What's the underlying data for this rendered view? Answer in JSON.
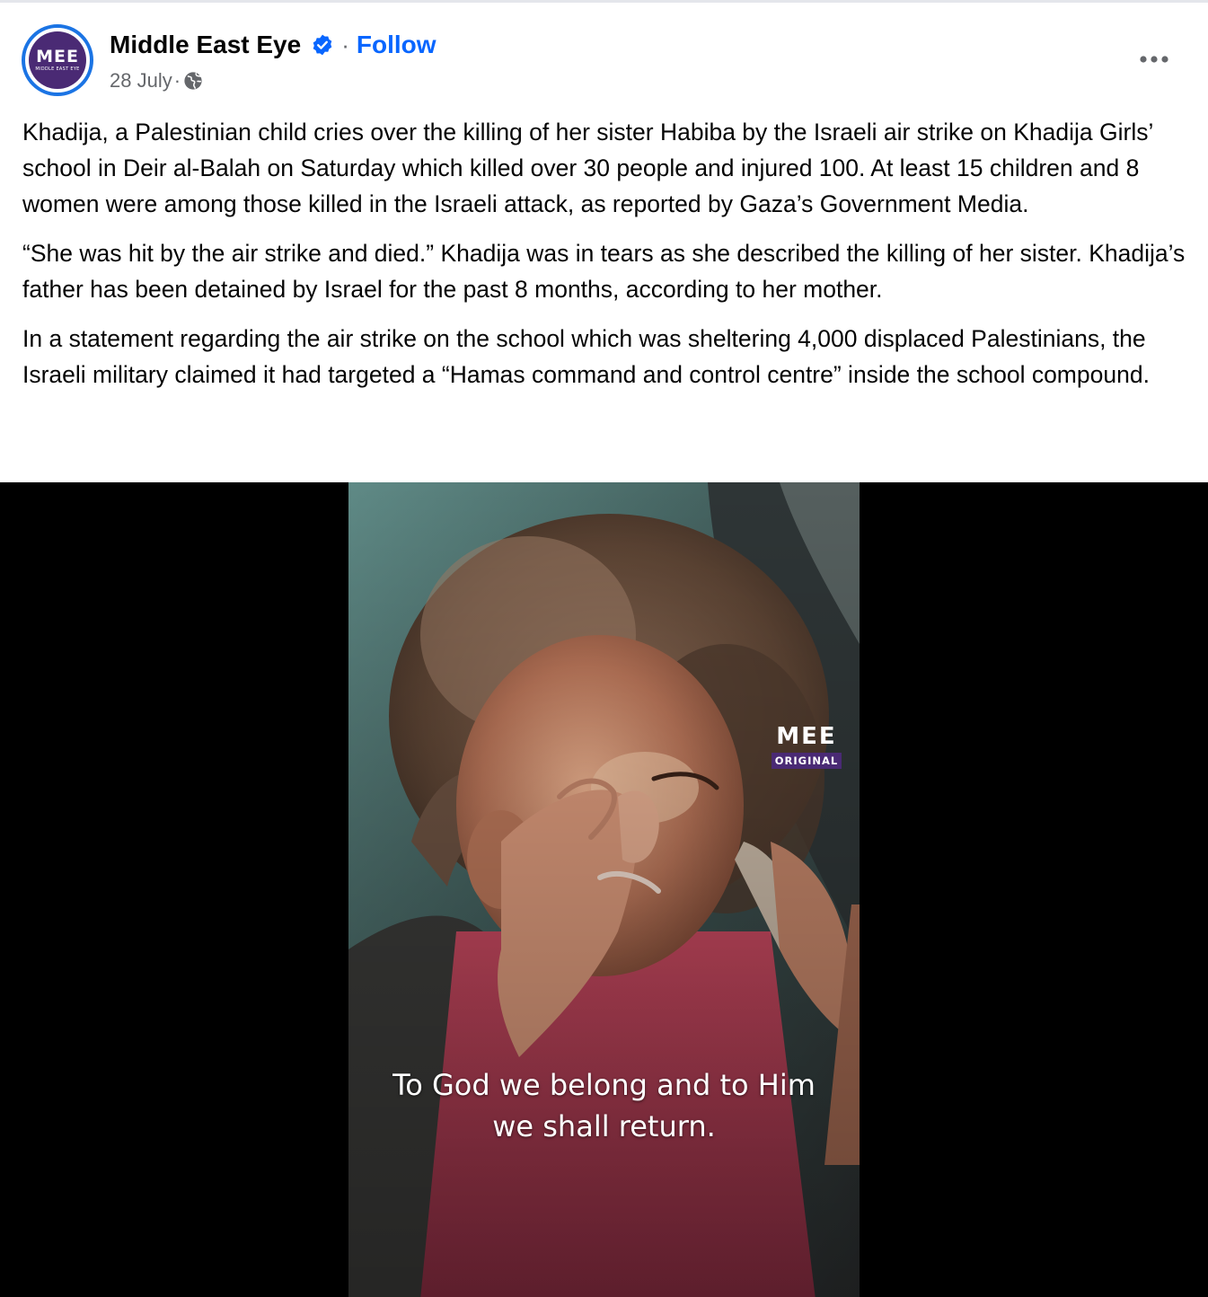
{
  "post": {
    "author": {
      "name": "Middle East Eye",
      "avatar_logo": "MEE",
      "avatar_subtext": "MIDDLE EAST EYE",
      "verified_icon": "verified-badge-icon"
    },
    "separator": "·",
    "follow_label": "Follow",
    "date": "28 July",
    "audience_icon": "globe-icon",
    "more_icon": "more-options-icon",
    "caption": [
      "Khadija, a Palestinian child cries over the killing of her sister Habiba by the Israeli air strike on Khadija Girls’ school in Deir al-Balah on Saturday which killed over 30 people and injured 100. At least 15 children and 8 women were among those killed in the Israeli attack, as reported by Gaza’s Government Media.",
      "“She was hit by the air strike and died.” Khadija was in tears as she described the killing of her sister. Khadija’s father has been detained by Israel for the past 8 months, according to her mother.",
      "In a statement regarding the air strike on the school which was sheltering 4,000 displaced Palestinians, the Israeli military claimed it had targeted a “Hamas command and control centre” inside the school compound."
    ],
    "media": {
      "watermark_logo": "MEE",
      "watermark_badge": "ORIGINAL",
      "subtitle_lines": [
        "To God we belong and to Him",
        "we shall return."
      ]
    }
  },
  "colors": {
    "link": "#0866ff",
    "verified": "#0866ff",
    "secondary_text": "#65676b",
    "avatar_ring": "#1b74e4",
    "brand_purple": "#4a2a74",
    "media_background": "#000000"
  }
}
